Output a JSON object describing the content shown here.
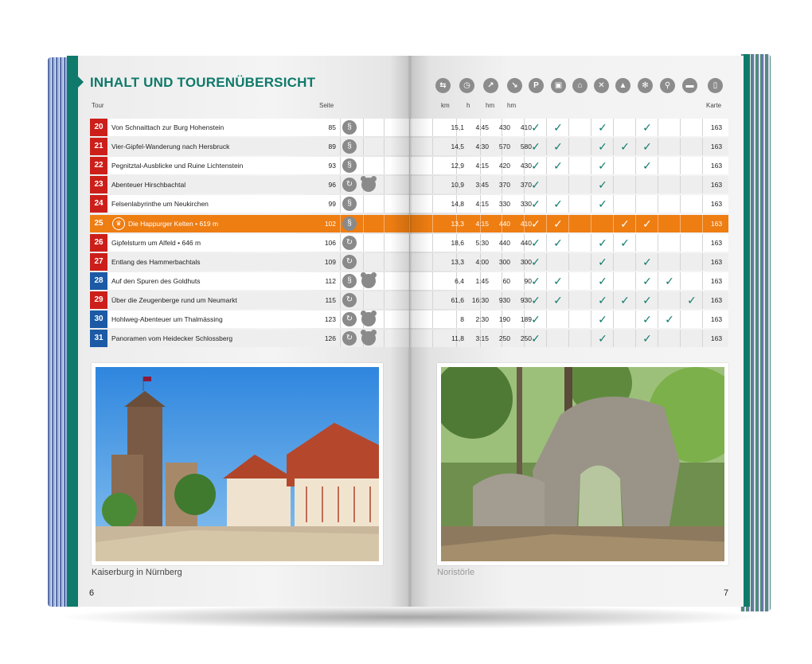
{
  "heading": "INHALT UND TOURENÜBERSICHT",
  "columns": {
    "tour": "Tour",
    "seite": "Seite",
    "km": "km",
    "h": "h",
    "hm_up": "hm",
    "hm_down": "hm",
    "karte": "Karte"
  },
  "header_icons": [
    "signpost-icon",
    "clock-icon",
    "ascent-icon",
    "descent-icon",
    "parking-icon",
    "bus-icon",
    "cable-car-icon",
    "restaurant-icon",
    "peak-icon",
    "winter-icon",
    "bike-icon",
    "bed-icon",
    "mobile-icon"
  ],
  "header_icon_glyphs": [
    "⇆",
    "◷",
    "↗",
    "↘",
    "P",
    "▣",
    "⌂",
    "✕",
    "▲",
    "✻",
    "⚲",
    "▬",
    "▯"
  ],
  "colors": {
    "teal": "#0f7a6b",
    "red_badge": "#cc1f1a",
    "blue_badge": "#1c5aa6",
    "highlight": "#ee7d12"
  },
  "check_glyph": "✓",
  "tours": [
    {
      "num": "20",
      "title": "Von Schnaittach zur Burg Hohenstein",
      "page": "85",
      "type": "linear",
      "kids": false,
      "km": "15,1",
      "h": "4:45",
      "up": "430",
      "down": "410",
      "checks": [
        1,
        1,
        0,
        1,
        0,
        1,
        0,
        0
      ],
      "karte": "163",
      "badge": "red",
      "highlight": false
    },
    {
      "num": "21",
      "title": "Vier-Gipfel-Wanderung nach Hersbruck",
      "page": "89",
      "type": "linear",
      "kids": false,
      "km": "14,5",
      "h": "4:30",
      "up": "570",
      "down": "580",
      "checks": [
        1,
        1,
        0,
        1,
        1,
        1,
        0,
        0
      ],
      "karte": "163",
      "badge": "red",
      "highlight": false
    },
    {
      "num": "22",
      "title": "Pegnitztal-Ausblicke und Ruine Lichtenstein",
      "page": "93",
      "type": "linear",
      "kids": false,
      "km": "12,9",
      "h": "4:15",
      "up": "420",
      "down": "430",
      "checks": [
        1,
        1,
        0,
        1,
        0,
        1,
        0,
        0
      ],
      "karte": "163",
      "badge": "red",
      "highlight": false
    },
    {
      "num": "23",
      "title": "Abenteuer Hirschbachtal",
      "page": "96",
      "type": "loop",
      "kids": true,
      "km": "10,9",
      "h": "3:45",
      "up": "370",
      "down": "370",
      "checks": [
        1,
        0,
        0,
        1,
        0,
        0,
        0,
        0
      ],
      "karte": "163",
      "badge": "red",
      "highlight": false
    },
    {
      "num": "24",
      "title": "Felsenlabyrinthe um Neukirchen",
      "page": "99",
      "type": "linear",
      "kids": false,
      "km": "14,8",
      "h": "4:15",
      "up": "330",
      "down": "330",
      "checks": [
        1,
        1,
        0,
        1,
        0,
        0,
        0,
        0
      ],
      "karte": "163",
      "badge": "red",
      "highlight": false
    },
    {
      "num": "25",
      "title": "Die Happurger Kelten • 619 m",
      "page": "102",
      "type": "linear",
      "kids": false,
      "km": "13,3",
      "h": "4:15",
      "up": "440",
      "down": "410",
      "checks": [
        1,
        1,
        0,
        0,
        1,
        1,
        0,
        0
      ],
      "karte": "163",
      "badge": "red",
      "highlight": true
    },
    {
      "num": "26",
      "title": "Gipfelsturm um Alfeld • 646 m",
      "page": "106",
      "type": "loop",
      "kids": false,
      "km": "18,6",
      "h": "5:30",
      "up": "440",
      "down": "440",
      "checks": [
        1,
        1,
        0,
        1,
        1,
        0,
        0,
        0
      ],
      "karte": "163",
      "badge": "red",
      "highlight": false
    },
    {
      "num": "27",
      "title": "Entlang des Hammerbachtals",
      "page": "109",
      "type": "loop",
      "kids": false,
      "km": "13,3",
      "h": "4:00",
      "up": "300",
      "down": "300",
      "checks": [
        1,
        0,
        0,
        1,
        0,
        1,
        0,
        0
      ],
      "karte": "163",
      "badge": "red",
      "highlight": false
    },
    {
      "num": "28",
      "title": "Auf den Spuren des Goldhuts",
      "page": "112",
      "type": "linear",
      "kids": true,
      "km": "6,4",
      "h": "1:45",
      "up": "60",
      "down": "90",
      "checks": [
        1,
        1,
        0,
        1,
        0,
        1,
        1,
        0
      ],
      "karte": "163",
      "badge": "blue",
      "highlight": false
    },
    {
      "num": "29",
      "title": "Über die Zeugenberge rund um Neumarkt",
      "page": "115",
      "type": "loop",
      "kids": false,
      "km": "61,6",
      "h": "16:30",
      "up": "930",
      "down": "930",
      "checks": [
        1,
        1,
        0,
        1,
        1,
        1,
        0,
        1
      ],
      "karte": "163",
      "badge": "red",
      "highlight": false
    },
    {
      "num": "30",
      "title": "Hohlweg-Abenteuer um Thalmässing",
      "page": "123",
      "type": "loop",
      "kids": true,
      "km": "8",
      "h": "2:30",
      "up": "190",
      "down": "189",
      "checks": [
        1,
        0,
        0,
        1,
        0,
        1,
        1,
        0
      ],
      "karte": "163",
      "badge": "blue",
      "highlight": false
    },
    {
      "num": "31",
      "title": "Panoramen vom Heidecker Schlossberg",
      "page": "126",
      "type": "loop",
      "kids": true,
      "km": "11,8",
      "h": "3:15",
      "up": "250",
      "down": "250",
      "checks": [
        1,
        0,
        0,
        1,
        0,
        1,
        0,
        0
      ],
      "karte": "163",
      "badge": "blue",
      "highlight": false
    }
  ],
  "captions": {
    "left": "Kaiserburg in Nürnberg",
    "right": "Noristörle"
  },
  "page_numbers": {
    "left": "6",
    "right": "7"
  }
}
